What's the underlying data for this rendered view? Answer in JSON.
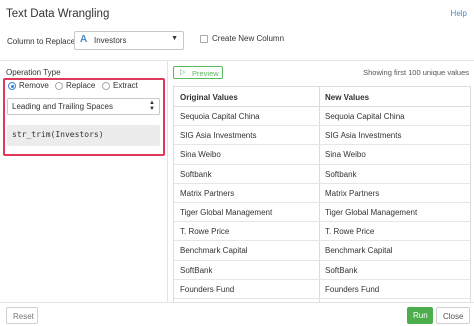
{
  "dialog": {
    "title": "Text Data Wrangling",
    "help_label": "Help"
  },
  "column": {
    "label": "Column to Replace",
    "type_icon": "character-type-icon",
    "type_glyph": "A",
    "value": "Investors",
    "create_new_label": "Create New Column",
    "create_new_checked": false
  },
  "operation": {
    "title": "Operation Type",
    "options": [
      {
        "label": "Remove",
        "selected": true
      },
      {
        "label": "Replace",
        "selected": false
      },
      {
        "label": "Extract",
        "selected": false
      }
    ],
    "target": "Leading and Trailing Spaces",
    "code": "str_trim(Investors)"
  },
  "preview": {
    "button_label": "Preview",
    "showing_text": "Showing first 100 unique values",
    "columns": [
      "Original Values",
      "New Values"
    ],
    "rows": [
      [
        "Sequoia Capital China",
        "Sequoia Capital China"
      ],
      [
        "SIG Asia Investments",
        "SIG Asia Investments"
      ],
      [
        "Sina Weibo",
        "Sina Weibo"
      ],
      [
        "Softbank",
        "Softbank"
      ],
      [
        "Matrix Partners",
        "Matrix Partners"
      ],
      [
        "Tiger Global Management",
        "Tiger Global Management"
      ],
      [
        "T. Rowe Price",
        "T. Rowe Price"
      ],
      [
        "Benchmark Capital",
        "Benchmark Capital"
      ],
      [
        "SoftBank",
        "SoftBank"
      ],
      [
        "Founders Fund",
        "Founders Fund"
      ]
    ]
  },
  "footer": {
    "reset_label": "Reset",
    "run_label": "Run",
    "close_label": "Close"
  },
  "colors": {
    "accent": "#4a8bc4",
    "highlight_border": "#e0385a",
    "run_green": "#4cae4c"
  }
}
